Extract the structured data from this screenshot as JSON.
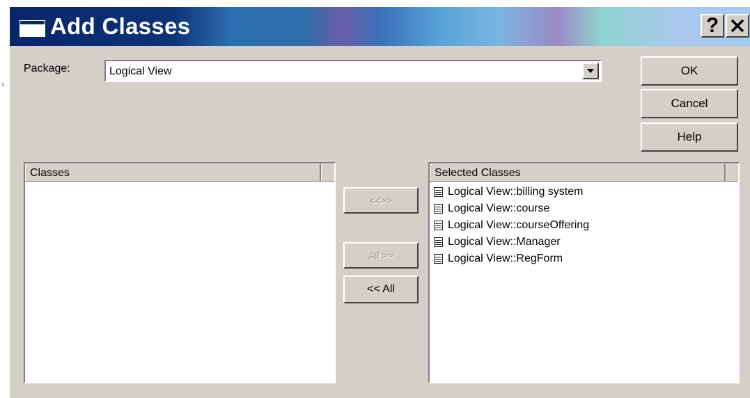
{
  "window": {
    "title": "Add Classes",
    "help_glyph": "?",
    "close_glyph": "×"
  },
  "package": {
    "label": "Package:",
    "selected": "Logical View"
  },
  "buttons": {
    "ok": "OK",
    "cancel": "Cancel",
    "help": "Help",
    "swap": "<<>>",
    "add_all": "All >>",
    "remove_all": "<< All"
  },
  "classes_list": {
    "header": "Classes",
    "items": []
  },
  "selected_list": {
    "header": "Selected Classes",
    "items": [
      "Logical View::billing system",
      "Logical View::course",
      "Logical View::courseOffering",
      "Logical View::Manager",
      "Logical View::RegForm"
    ]
  },
  "icons": {
    "title": "window-icon",
    "item": "class-icon",
    "dropdown": "chevron-down-icon"
  }
}
